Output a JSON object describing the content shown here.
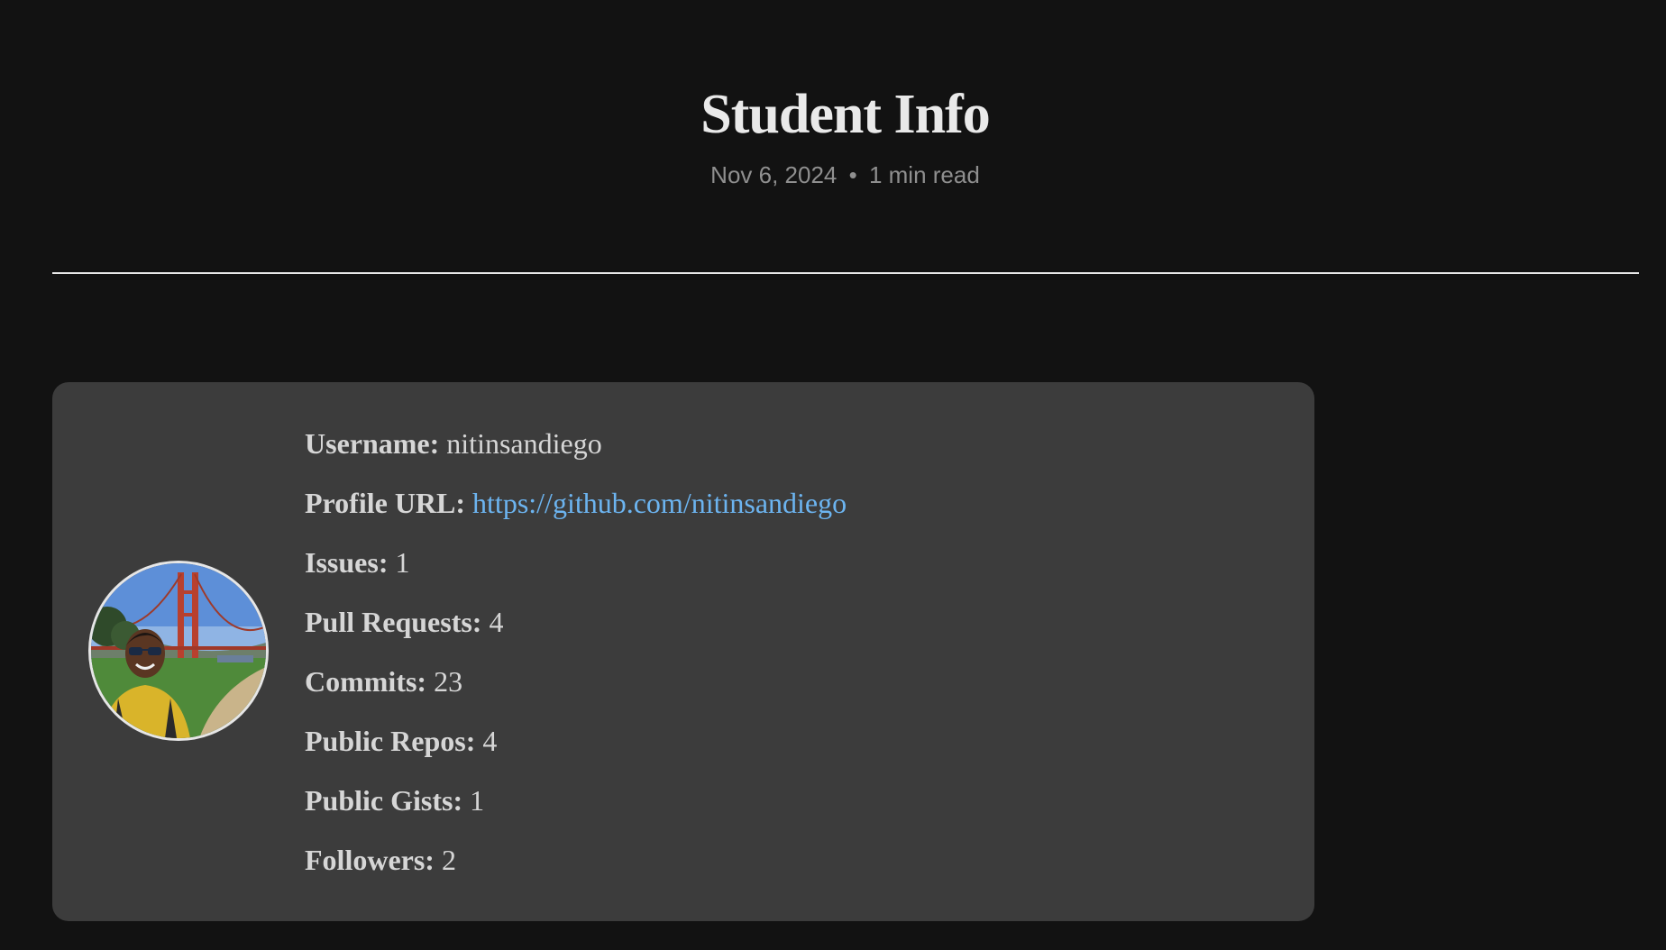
{
  "header": {
    "title": "Student Info",
    "date": "Nov 6, 2024",
    "separator": "•",
    "read_time": "1 min read"
  },
  "profile": {
    "avatar_icon": "profile-photo",
    "fields": [
      {
        "label": "Username:",
        "value": "nitinsandiego"
      },
      {
        "label": "Profile URL:",
        "value": "https://github.com/nitinsandiego"
      },
      {
        "label": "Issues:",
        "value": "1"
      },
      {
        "label": "Pull Requests:",
        "value": "4"
      },
      {
        "label": "Commits:",
        "value": "23"
      },
      {
        "label": "Public Repos:",
        "value": "4"
      },
      {
        "label": "Public Gists:",
        "value": "1"
      },
      {
        "label": "Followers:",
        "value": "2"
      }
    ]
  },
  "colors": {
    "background": "#121212",
    "card": "#3c3c3c",
    "link": "#6cb4f0",
    "text": "#d6d6d6"
  }
}
